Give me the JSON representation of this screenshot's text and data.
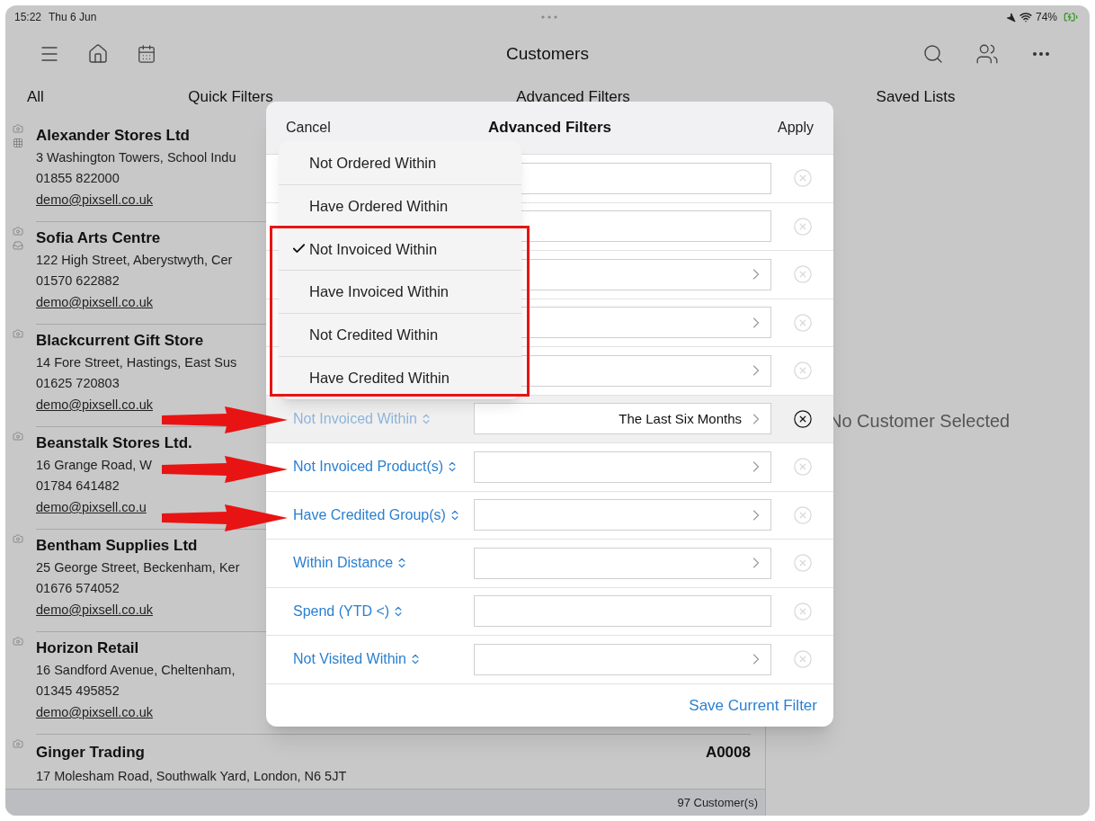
{
  "status_bar": {
    "time": "15:22",
    "date": "Thu 6 Jun",
    "battery": "74%"
  },
  "nav": {
    "title": "Customers"
  },
  "tabs": [
    {
      "label": "All"
    },
    {
      "label": "Quick Filters"
    },
    {
      "label": "Advanced Filters"
    },
    {
      "label": "Saved Lists"
    }
  ],
  "customers": [
    {
      "name": "Alexander Stores Ltd",
      "address": "3 Washington Towers, School Indu",
      "phone": "01855 822000",
      "email": "demo@pixsell.co.uk",
      "kind": "grid"
    },
    {
      "name": "Sofia Arts Centre",
      "address": "122 High Street, Aberystwyth, Cer",
      "phone": "01570 622882",
      "email": "demo@pixsell.co.uk",
      "kind": "tray"
    },
    {
      "name": "Blackcurrent Gift Store",
      "address": "14 Fore Street, Hastings, East Sus",
      "phone": "01625 720803",
      "email": "demo@pixsell.co.uk",
      "kind": "plain"
    },
    {
      "name": "Beanstalk Stores Ltd.",
      "address": "16 Grange Road, W",
      "phone": "01784 641482",
      "email": "demo@pixsell.co.u",
      "kind": "plain"
    },
    {
      "name": "Bentham Supplies Ltd",
      "address": "25 George Street, Beckenham, Ker",
      "phone": "01676 574052",
      "email": "demo@pixsell.co.uk",
      "kind": "plain"
    },
    {
      "name": "Horizon Retail",
      "address": "16 Sandford Avenue, Cheltenham,",
      "phone": "01345 495852",
      "email": "demo@pixsell.co.uk",
      "kind": "plain"
    },
    {
      "name": "Ginger Trading",
      "code": "A0008",
      "address": "17 Molesham Road, Southwalk Yard, London, N6 5JT",
      "kind": "plain"
    }
  ],
  "list_footer": "97 Customer(s)",
  "detail": {
    "empty_message": "No Customer Selected"
  },
  "modal": {
    "title": "Advanced Filters",
    "cancel": "Cancel",
    "apply": "Apply",
    "footer_link": "Save Current Filter",
    "rows": [
      {
        "kind": "text",
        "selected": false
      },
      {
        "kind": "text",
        "selected": false
      },
      {
        "kind": "picker",
        "selected": false
      },
      {
        "kind": "picker",
        "selected": false
      },
      {
        "kind": "picker",
        "selected": false
      },
      {
        "kind": "picker",
        "label": "Not Invoiced Within",
        "value": "The Last Six Months",
        "selected": true
      },
      {
        "kind": "picker",
        "label": "Not Invoiced Product(s)",
        "selected": false
      },
      {
        "kind": "picker",
        "label": "Have Credited Group(s)",
        "selected": false
      },
      {
        "kind": "picker",
        "label": "Within Distance",
        "selected": false
      },
      {
        "kind": "text",
        "label": "Spend (YTD <)",
        "selected": false
      },
      {
        "kind": "picker",
        "label": "Not Visited Within",
        "selected": false
      }
    ]
  },
  "menu": [
    {
      "label": "Not Ordered Within",
      "checked": false
    },
    {
      "label": "Have Ordered Within",
      "checked": false
    },
    {
      "label": "Not Invoiced Within",
      "checked": true
    },
    {
      "label": "Have Invoiced Within",
      "checked": false
    },
    {
      "label": "Not Credited Within",
      "checked": false
    },
    {
      "label": "Have Credited Within",
      "checked": false
    }
  ]
}
